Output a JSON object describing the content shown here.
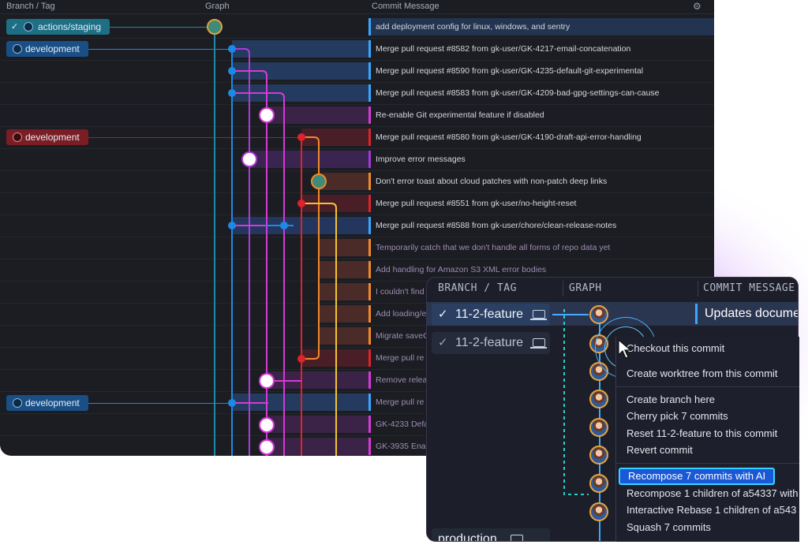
{
  "colors": {
    "teal": "#1f8aa8",
    "blue": "#1e88e5",
    "magenta": "#d63ad6",
    "red": "#e0222a",
    "orange": "#f08a2a",
    "yellow": "#f4c430",
    "purple": "#a23ad8",
    "accent_highlight": "#1958d6"
  },
  "main_window": {
    "header": {
      "branch_tag": "Branch / Tag",
      "graph": "Graph",
      "commit_message": "Commit Message",
      "settings_icon": "gear-icon"
    },
    "branches": [
      {
        "label": "actions/staging",
        "checked": true,
        "style": "teal"
      },
      {
        "label": "development",
        "checked": false,
        "style": "blue"
      },
      {
        "label": "development",
        "checked": false,
        "style": "red"
      },
      {
        "label": "development",
        "checked": false,
        "style": "blue"
      }
    ],
    "commits": [
      "add deployment config for linux, windows, and sentry",
      "Merge pull request #8582 from gk-user/GK-4217-email-concatenation",
      "Merge pull request #8590 from gk-user/GK-4235-default-git-experimental",
      "Merge pull request #8583 from gk-user/GK-4209-bad-gpg-settings-can-cause",
      "Re-enable Git experimental feature if disabled",
      "Merge pull request #8580 from gk-user/GK-4190-draft-api-error-handling",
      "Improve error messages",
      "Don't error toast about cloud patches with non-patch deep links",
      "Merge pull request #8551 from gk-user/no-height-reset",
      "Merge pull request #8588 from gk-user/chore/clean-release-notes",
      "Temporarily catch that we don't handle all forms of repo data yet",
      "Add handling for Amazon S3 XML error bodies",
      "I couldn't find",
      "Add loading/e",
      "Migrate saveC",
      "Merge pull re",
      "Remove relea",
      "Merge pull re",
      "GK-4233 Defa",
      "GK-3935 Enab"
    ]
  },
  "overlay_window": {
    "header": {
      "branch_tag": "BRANCH / TAG",
      "graph": "GRAPH",
      "commit_message": "COMMIT MESSAGE"
    },
    "branches": [
      {
        "label": "11-2-feature",
        "checked": true,
        "device_icon": "laptop-icon"
      },
      {
        "label": "11-2-feature",
        "checked": true,
        "device_icon": "laptop-icon"
      },
      {
        "label": "production",
        "checked": false,
        "device_icon": "laptop-icon"
      }
    ],
    "first_commit_message": "Updates docume",
    "context_menu": {
      "items": [
        "Checkout this commit",
        "Create worktree from this commit",
        "Create branch here",
        "Cherry pick 7 commits",
        "Reset 11-2-feature to this commit",
        "Revert commit",
        "Recompose 7 commits with AI",
        "Recompose 1 children of a54337 with",
        "Interactive Rebase 1 children of a543",
        "Squash 7 commits"
      ],
      "highlighted_index": 6
    }
  }
}
